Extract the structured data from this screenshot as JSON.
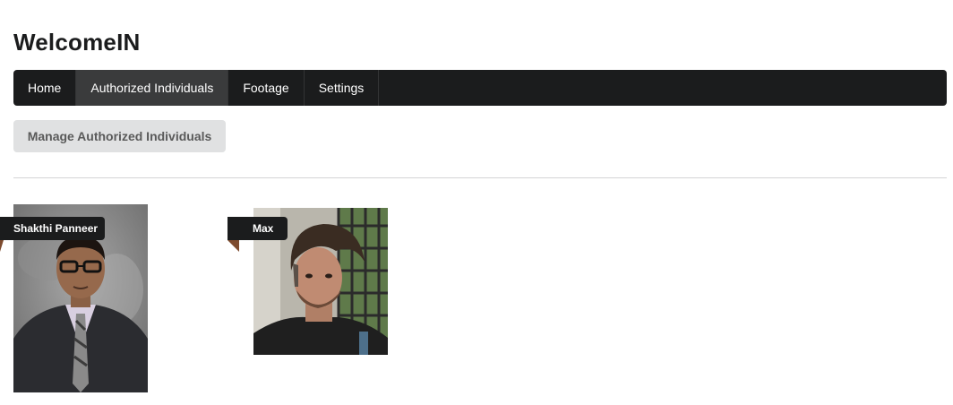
{
  "app": {
    "title": "WelcomeIN"
  },
  "nav": {
    "items": [
      {
        "label": "Home",
        "active": false
      },
      {
        "label": "Authorized Individuals",
        "active": true
      },
      {
        "label": "Footage",
        "active": false
      },
      {
        "label": "Settings",
        "active": false
      }
    ]
  },
  "actions": {
    "manage_label": "Manage Authorized Individuals"
  },
  "individuals": [
    {
      "name": "Shakthi Panneer"
    },
    {
      "name": "Max"
    }
  ],
  "colors": {
    "menu_bg": "#1b1c1d",
    "menu_active": "#3a3b3c",
    "button_bg": "#e0e1e2",
    "ribbon_bg": "#1b1c1d",
    "ribbon_fold": "#7d4b2e"
  }
}
